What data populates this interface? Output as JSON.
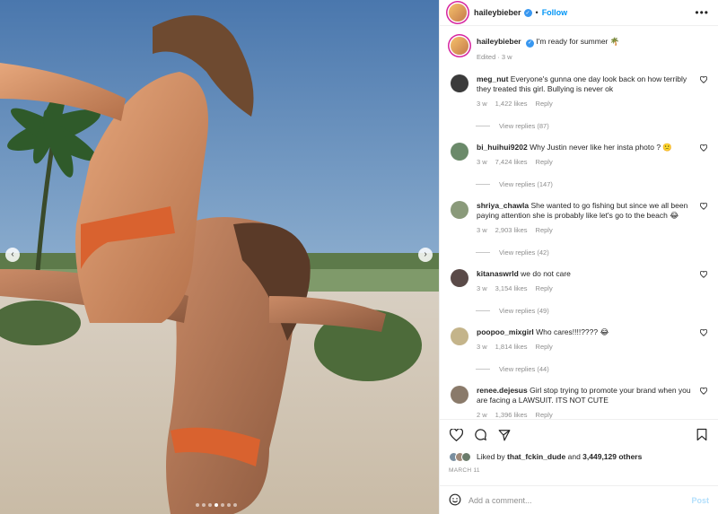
{
  "post": {
    "username": "haileybieber",
    "follow_label": "Follow",
    "separator": "•",
    "more_label": "•••",
    "caption_text": "I'm ready for summer",
    "caption_emoji": "🌴",
    "edited_label": "Edited · 3 w",
    "liked_by_prefix": "Liked by",
    "liked_by_user": "that_fckin_dude",
    "liked_by_and": "and",
    "liked_by_others": "3,449,129 others",
    "date": "MARCH 11",
    "comment_placeholder": "Add a comment...",
    "post_label": "Post"
  },
  "carousel": {
    "total": 7,
    "active": 4
  },
  "comments": [
    {
      "user": "meg_nut",
      "text": "Everyone's gunna one day look back on how terribly they treated this girl. Bullying is never ok",
      "age": "3 w",
      "likes": "1,422 likes",
      "reply": "Reply",
      "view_replies": "View replies (87)"
    },
    {
      "user": "bi_huihui9202",
      "text": "Why Justin never like her insta photo ? 🙁",
      "age": "3 w",
      "likes": "7,424 likes",
      "reply": "Reply",
      "view_replies": "View replies (147)"
    },
    {
      "user": "shriya_chawla",
      "text": "She wanted to go fishing but since we all been paying attention she is probably like let's go to the beach 😂",
      "age": "3 w",
      "likes": "2,903 likes",
      "reply": "Reply",
      "view_replies": "View replies (42)"
    },
    {
      "user": "kitanaswrld",
      "text": "we do not care",
      "age": "3 w",
      "likes": "3,154 likes",
      "reply": "Reply",
      "view_replies": "View replies (49)"
    },
    {
      "user": "poopoo_mixgirl",
      "text": "Who cares!!!!???? 😂",
      "age": "3 w",
      "likes": "1,814 likes",
      "reply": "Reply",
      "view_replies": "View replies (44)"
    },
    {
      "user": "renee.dejesus",
      "text": "Girl stop trying to promote your brand when you are facing a LAWSUIT. ITS NOT CUTE",
      "age": "2 w",
      "likes": "1,396 likes",
      "reply": "Reply",
      "view_replies": ""
    }
  ],
  "icons": {
    "prev": "chevron-left-icon",
    "next": "chevron-right-icon",
    "like": "heart-icon",
    "comment": "comment-icon",
    "share": "send-icon",
    "save": "bookmark-icon",
    "emoji": "emoji-icon",
    "verified": "verified-badge-icon"
  },
  "colors": {
    "accent": "#0095f6",
    "post_disabled": "#b2dffc",
    "muted": "#8e8e8e",
    "text": "#262626"
  }
}
